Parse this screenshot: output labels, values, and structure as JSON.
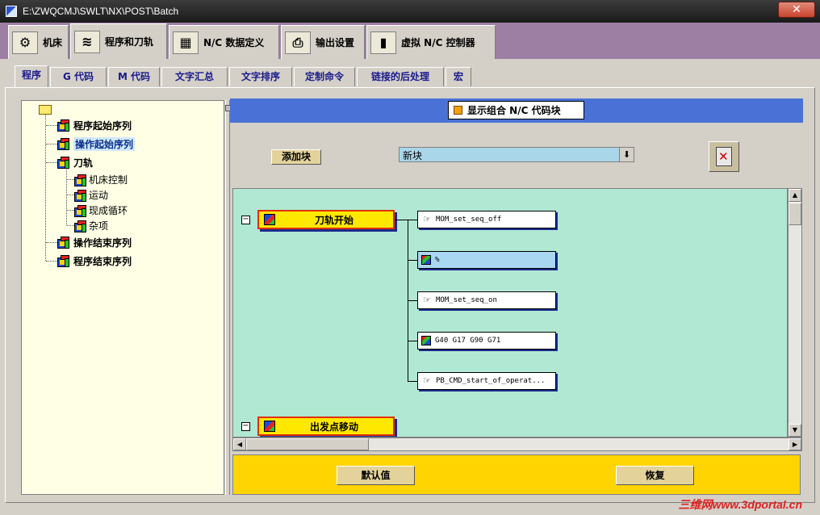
{
  "window": {
    "title": "E:\\ZWQCMJ\\SWLT\\NX\\POST\\Batch",
    "close": "✕"
  },
  "main_tabs": [
    {
      "label": "机床",
      "icon": "machine-icon"
    },
    {
      "label": "程序和刀轨",
      "icon": "program-path-icon"
    },
    {
      "label": "N/C 数据定义",
      "icon": "nc-data-icon"
    },
    {
      "label": "输出设置",
      "icon": "printer-icon"
    },
    {
      "label": "虚拟 N/C 控制器",
      "icon": "controller-icon"
    }
  ],
  "sub_tabs": [
    "程序",
    "G 代码",
    "M 代码",
    "文字汇总",
    "文字排序",
    "定制命令",
    "链接的后处理",
    "宏"
  ],
  "tree": {
    "items": [
      {
        "label": "程序起始序列"
      },
      {
        "label": "操作起始序列"
      },
      {
        "label": "刀轨"
      },
      {
        "label": "机床控制"
      },
      {
        "label": "运动"
      },
      {
        "label": "现成循环"
      },
      {
        "label": "杂项"
      },
      {
        "label": "操作结束序列"
      },
      {
        "label": "程序结束序列"
      }
    ]
  },
  "header": {
    "show_combined": "显示组合 N/C 代码块"
  },
  "toolbar": {
    "add_block": "添加块",
    "block_value": "新块",
    "dropdown_arrow": "⬇"
  },
  "canvas": {
    "events": [
      "刀轨开始",
      "出发点移动"
    ],
    "commands": [
      "MOM_set_seq_off",
      "%",
      "MOM_set_seq_on",
      "G40 G17 G90 G71",
      "PB_CMD_start_of_operat..."
    ]
  },
  "bottom": {
    "default": "默认值",
    "restore": "恢复"
  },
  "watermark": "三维网www.3dportal.cn",
  "colors": {
    "header_band": "#4a72d6",
    "canvas_bg": "#b0e8d4",
    "bottom_bar": "#ffd400",
    "tabs_bg": "#9d7fa4"
  }
}
